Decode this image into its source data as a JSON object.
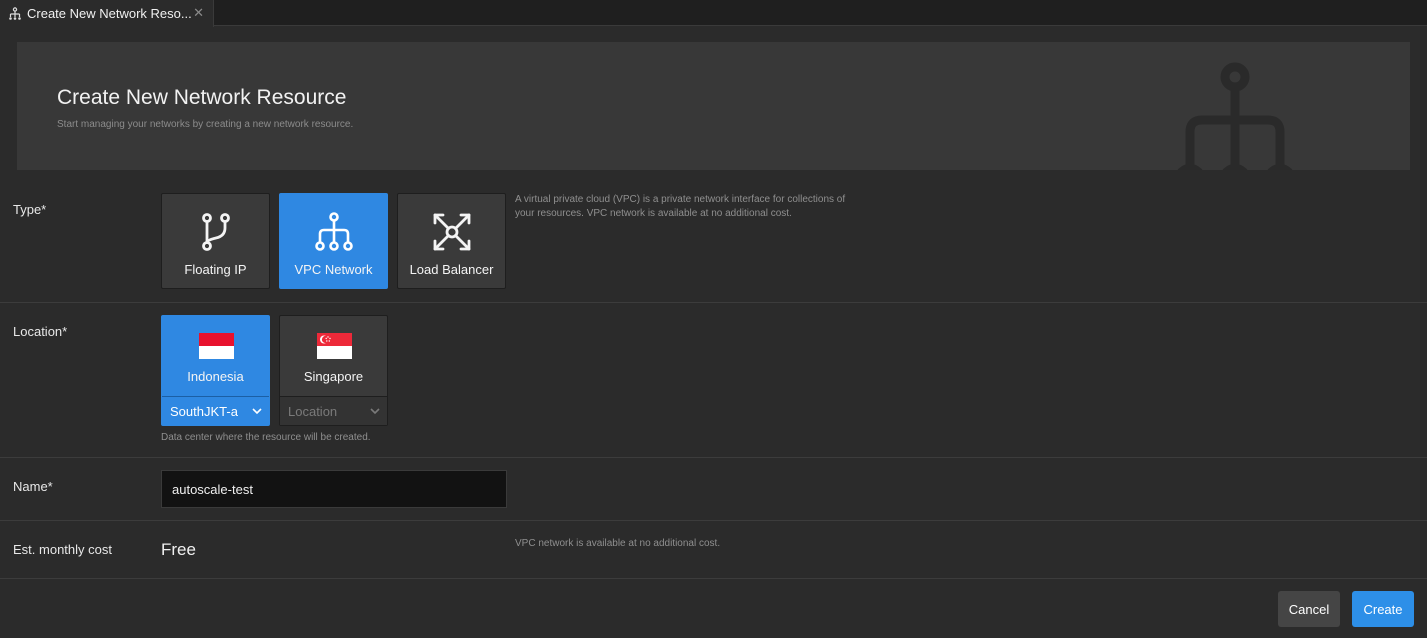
{
  "tab": {
    "title": "Create New Network Reso...",
    "icon": "network-icon",
    "close": "✕"
  },
  "header": {
    "title": "Create New Network Resource",
    "subtitle": "Start managing your networks by creating a new network resource."
  },
  "type_section": {
    "label": "Type*",
    "options": [
      {
        "label": "Floating IP",
        "icon": "fork-icon",
        "selected": false
      },
      {
        "label": "VPC Network",
        "icon": "network-tree-icon",
        "selected": true
      },
      {
        "label": "Load Balancer",
        "icon": "load-balancer-icon",
        "selected": false
      }
    ],
    "description": "A virtual private cloud (VPC) is a private network interface for collections of your resources. VPC network is available at no additional cost."
  },
  "location_section": {
    "label": "Location*",
    "options": [
      {
        "label": "Indonesia",
        "flag": "indonesia-flag",
        "selected": true,
        "zone": "SouthJKT-a"
      },
      {
        "label": "Singapore",
        "flag": "singapore-flag",
        "selected": false,
        "zone": "Location"
      }
    ],
    "help": "Data center where the resource will be created."
  },
  "name_section": {
    "label": "Name*",
    "value": "autoscale-test"
  },
  "cost_section": {
    "label": "Est. monthly cost",
    "value": "Free",
    "note": "VPC network is available at no additional cost."
  },
  "footer": {
    "cancel_label": "Cancel",
    "create_label": "Create"
  },
  "colors": {
    "accent": "#2f88e2",
    "background": "#2b2b2b",
    "card": "#3a3a3a"
  }
}
